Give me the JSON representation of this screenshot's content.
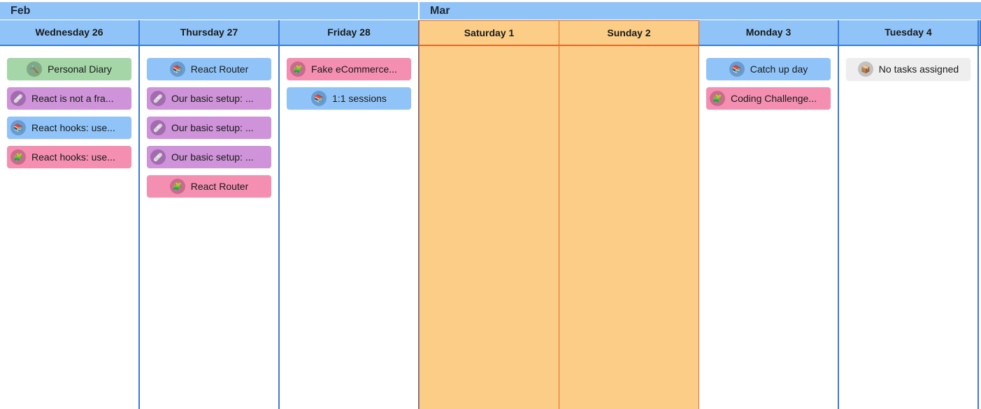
{
  "months": [
    {
      "name": "Feb"
    },
    {
      "name": "Mar"
    }
  ],
  "days": [
    {
      "label": "Wednesday 26"
    },
    {
      "label": "Thursday 27"
    },
    {
      "label": "Friday 28"
    },
    {
      "label": "Saturday 1"
    },
    {
      "label": "Sunday 2"
    },
    {
      "label": "Monday 3"
    },
    {
      "label": "Tuesday 4"
    }
  ],
  "tasks": {
    "wed": [
      {
        "label": "Personal Diary",
        "color": "#a5d6a7",
        "icon": "hammer-icon"
      },
      {
        "label": "React is not a fra...",
        "color": "#ce93d8",
        "icon": "bandage-icon"
      },
      {
        "label": "React hooks: use...",
        "color": "#90c4f8",
        "icon": "books-icon"
      },
      {
        "label": "React hooks: use...",
        "color": "#f48fb1",
        "icon": "puzzle-icon"
      }
    ],
    "thu": [
      {
        "label": "React Router",
        "color": "#90c4f8",
        "icon": "books-icon"
      },
      {
        "label": "Our basic setup: ...",
        "color": "#ce93d8",
        "icon": "bandage-icon"
      },
      {
        "label": "Our basic setup: ...",
        "color": "#ce93d8",
        "icon": "bandage-icon"
      },
      {
        "label": "Our basic setup: ...",
        "color": "#ce93d8",
        "icon": "bandage-icon"
      },
      {
        "label": "React Router",
        "color": "#f48fb1",
        "icon": "puzzle-icon"
      }
    ],
    "fri": [
      {
        "label": "Fake eCommerce...",
        "color": "#f48fb1",
        "icon": "puzzle-icon"
      },
      {
        "label": "1:1 sessions",
        "color": "#90c4f8",
        "icon": "books-icon"
      }
    ],
    "mon": [
      {
        "label": "Catch up day",
        "color": "#90c4f8",
        "icon": "books-icon"
      },
      {
        "label": "Coding Challenge...",
        "color": "#f48fb1",
        "icon": "puzzle-icon"
      }
    ],
    "tue": [
      {
        "label": "No tasks assigned",
        "color": "#eeeeee",
        "icon": "box-icon"
      }
    ]
  },
  "colors": {
    "header_blue": "#90c4f8",
    "weekend_orange": "#fbcd87",
    "column_border": "#3b7bd6",
    "weekend_border": "#e06a26"
  }
}
